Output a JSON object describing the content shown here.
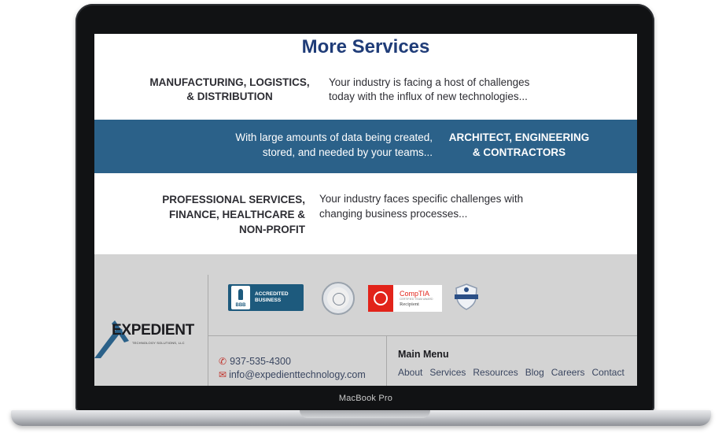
{
  "device": {
    "model_label": "MacBook Pro"
  },
  "page": {
    "title": "More Services"
  },
  "services": [
    {
      "label_lines": [
        "MANUFACTURING, LOGISTICS,",
        "& DISTRIBUTION"
      ],
      "desc_lines": [
        "Your industry is facing a host of challenges",
        "today with the influx of new technologies..."
      ]
    },
    {
      "label_lines": [
        "ARCHITECT, ENGINEERING",
        "& CONTRACTORS"
      ],
      "desc_lines": [
        "With large amounts of data being created,",
        "stored, and needed by your teams..."
      ]
    },
    {
      "label_lines": [
        "PROFESSIONAL SERVICES,",
        "FINANCE, HEALTHCARE &",
        "NON-PROFIT"
      ],
      "desc_lines": [
        "Your industry faces specific challenges with",
        "changing business processes..."
      ]
    }
  ],
  "colors": {
    "title": "#1f3c78",
    "band": "#2b6189",
    "footer_bg": "#d3d3d3",
    "bbb": "#1d5a7d",
    "comptia_red": "#e2231a"
  },
  "footer": {
    "logo": {
      "wordmark": "EXPEDIENT",
      "tagline": "TECHNOLOGY SOLUTIONS, LLC"
    },
    "badges": {
      "bbb_short": "BBB",
      "bbb_line1": "ACCREDITED",
      "bbb_line2": "BUSINESS",
      "comptia_name": "CompTIA",
      "comptia_small": "CERTIFIED TEAM AWARD",
      "comptia_recipient": "Recipient"
    },
    "contact": {
      "phone": "937-535-4300",
      "email": "info@expedienttechnology.com",
      "phone_icon": "phone-icon",
      "email_icon": "envelope-icon"
    },
    "menu": {
      "title": "Main Menu",
      "links": [
        "About",
        "Services",
        "Resources",
        "Blog",
        "Careers",
        "Contact"
      ]
    }
  }
}
